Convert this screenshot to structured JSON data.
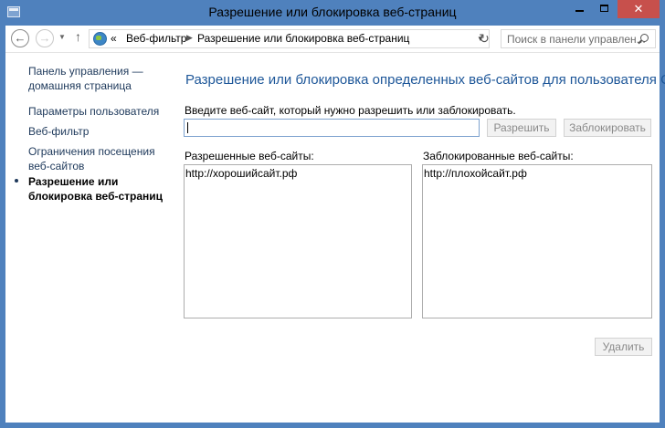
{
  "window": {
    "title": "Разрешение или блокировка веб-страниц",
    "close_glyph": "✕"
  },
  "addressbar": {
    "back_glyph": "←",
    "forward_glyph": "→",
    "dropdown_glyph": "▼",
    "up_glyph": "↑",
    "overflow_glyph": "«",
    "separator_glyph": "▶",
    "crumbs": [
      "Веб-фильтр",
      "Разрешение или блокировка веб-страниц"
    ],
    "refresh_glyph": "↻",
    "search_placeholder": "Поиск в панели управлен..."
  },
  "sidebar": {
    "items": [
      {
        "line1": "Панель управления —",
        "line2": "домашняя страница"
      },
      {
        "line1": "Параметры пользователя"
      },
      {
        "line1": "Веб-фильтр"
      },
      {
        "line1": "Ограничения посещения",
        "line2": "веб-сайтов"
      },
      {
        "line1": "Разрешение или",
        "line2": "блокировка веб-страниц"
      }
    ]
  },
  "main": {
    "heading": "Разрешение или блокировка определенных веб-сайтов для пользователя Сын",
    "input_label": "Введите веб-сайт, который нужно разрешить или заблокировать.",
    "input_value": "",
    "allow_button": "Разрешить",
    "block_button": "Заблокировать",
    "allowed_label": "Разрешенные веб-сайты:",
    "blocked_label": "Заблокированные веб-сайты:",
    "allowed_sites": [
      "http://хорошийсайт.рф"
    ],
    "blocked_sites": [
      "http://плохойсайт.рф"
    ],
    "delete_button": "Удалить"
  },
  "colors": {
    "frame": "#4f81bd",
    "close": "#c7504c",
    "link": "#1e395b",
    "heading": "#1e5799"
  }
}
